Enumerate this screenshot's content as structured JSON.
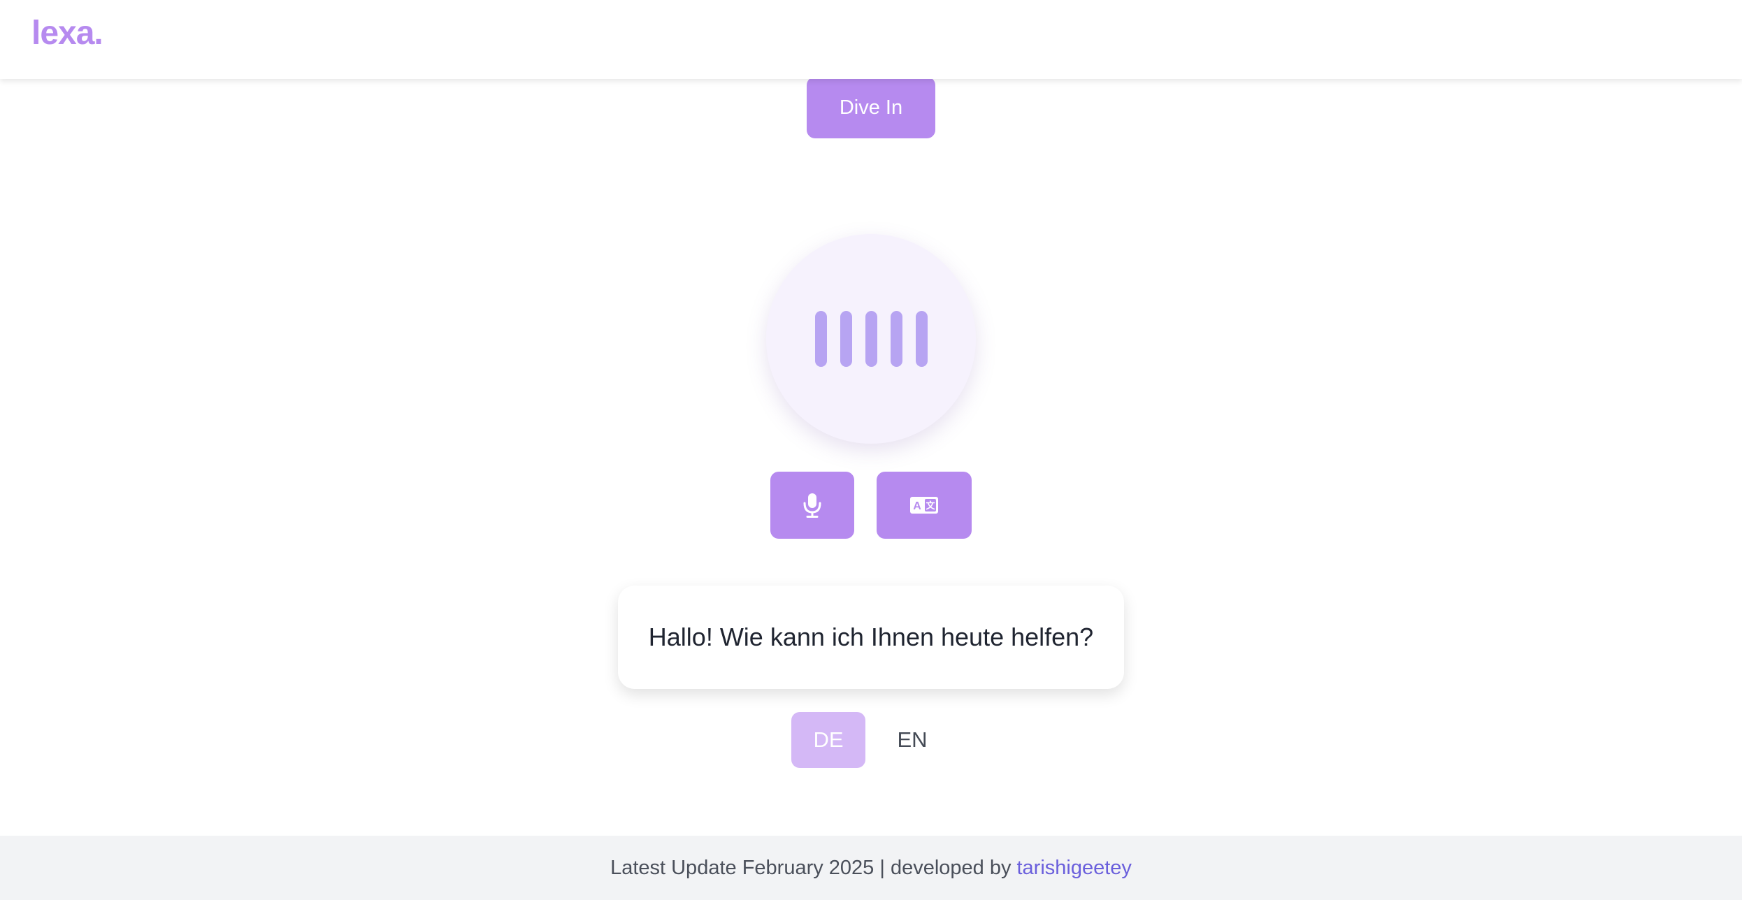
{
  "header": {
    "logo_text": "lexa."
  },
  "hero": {
    "dive_in_label": "Dive In"
  },
  "voice_visualizer": {
    "bar_count": 5,
    "bar_color": "#b7a4f2"
  },
  "controls": {
    "mic_icon": "microphone-icon",
    "translate_icon": "translate-icon"
  },
  "message": {
    "text": "Hallo! Wie kann ich Ihnen heute helfen?"
  },
  "language": {
    "options": [
      "DE",
      "EN"
    ],
    "selected": "DE"
  },
  "footer": {
    "text": "Latest Update February 2025 | developed by",
    "link_text": "tarishigeetey"
  },
  "colors": {
    "accent": "#b68aef",
    "accent_light": "#d4b8f6",
    "link": "#6a5fdc",
    "footer_bg": "#f2f3f5"
  }
}
